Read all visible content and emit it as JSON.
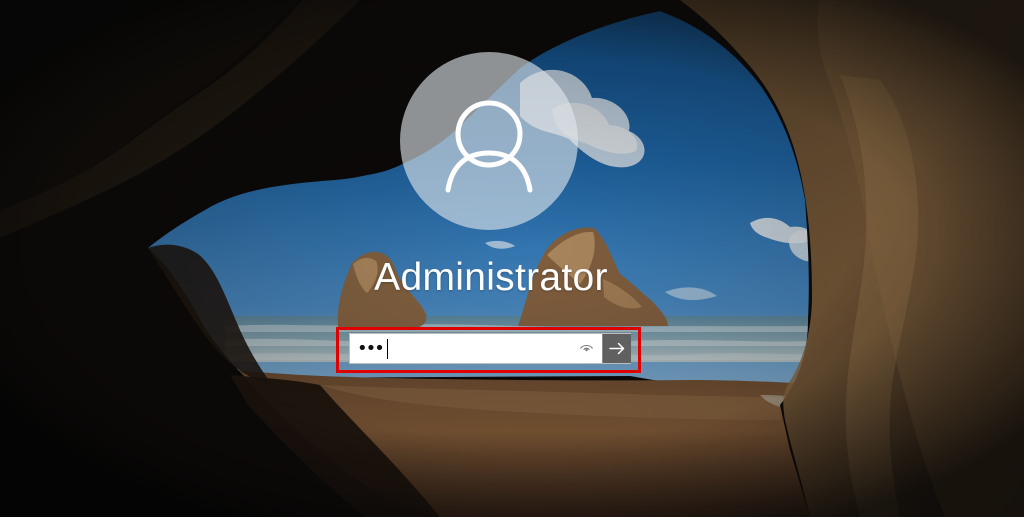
{
  "login": {
    "username": "Administrator",
    "password_masked": "•••"
  },
  "icons": {
    "avatar": "user-silhouette-icon",
    "reveal": "eye-icon",
    "submit": "arrow-right-icon"
  },
  "colors": {
    "highlight_border": "#e00000",
    "submit_button": "#606060",
    "field_background": "#ffffff",
    "text": "#ffffff"
  }
}
